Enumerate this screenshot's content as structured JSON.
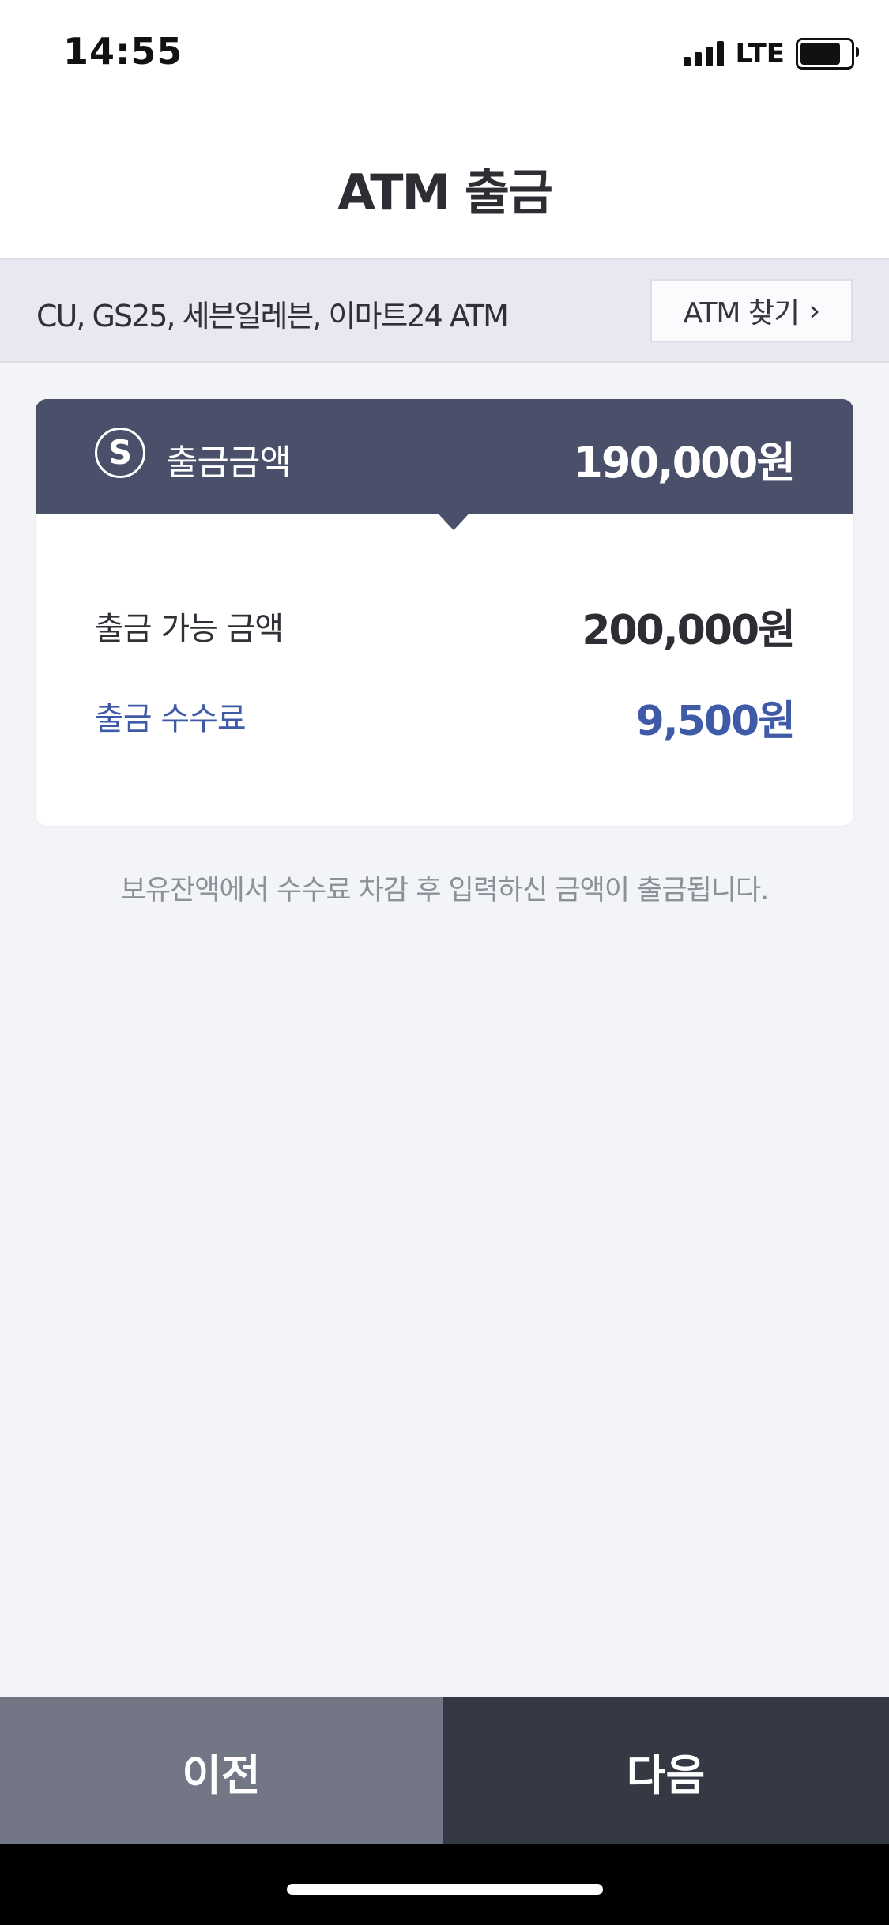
{
  "status_bar": {
    "time": "14:55",
    "network": "LTE",
    "signal_bars": 4,
    "battery_level": 0.8
  },
  "header": {
    "title": "ATM 출금"
  },
  "banner": {
    "text": "CU, GS25, 세븐일레븐, 이마트24 ATM",
    "find_button_label": "ATM 찾기"
  },
  "card": {
    "header_icon": "s-coin-icon",
    "header_icon_text": "S",
    "withdraw_label": "출금금액",
    "withdraw_amount": "190,000원",
    "available_label": "출금 가능 금액",
    "available_amount": "200,000원",
    "fee_label": "출금 수수료",
    "fee_amount": "9,500원"
  },
  "notice": "보유잔액에서 수수료 차감 후 입력하신 금액이 출금됩니다.",
  "buttons": {
    "prev_label": "이전",
    "next_label": "다음"
  },
  "colors": {
    "card_header": "#4a5069",
    "fee_accent": "#3f5aa6",
    "prev_button": "#737785",
    "next_button": "#353944"
  }
}
